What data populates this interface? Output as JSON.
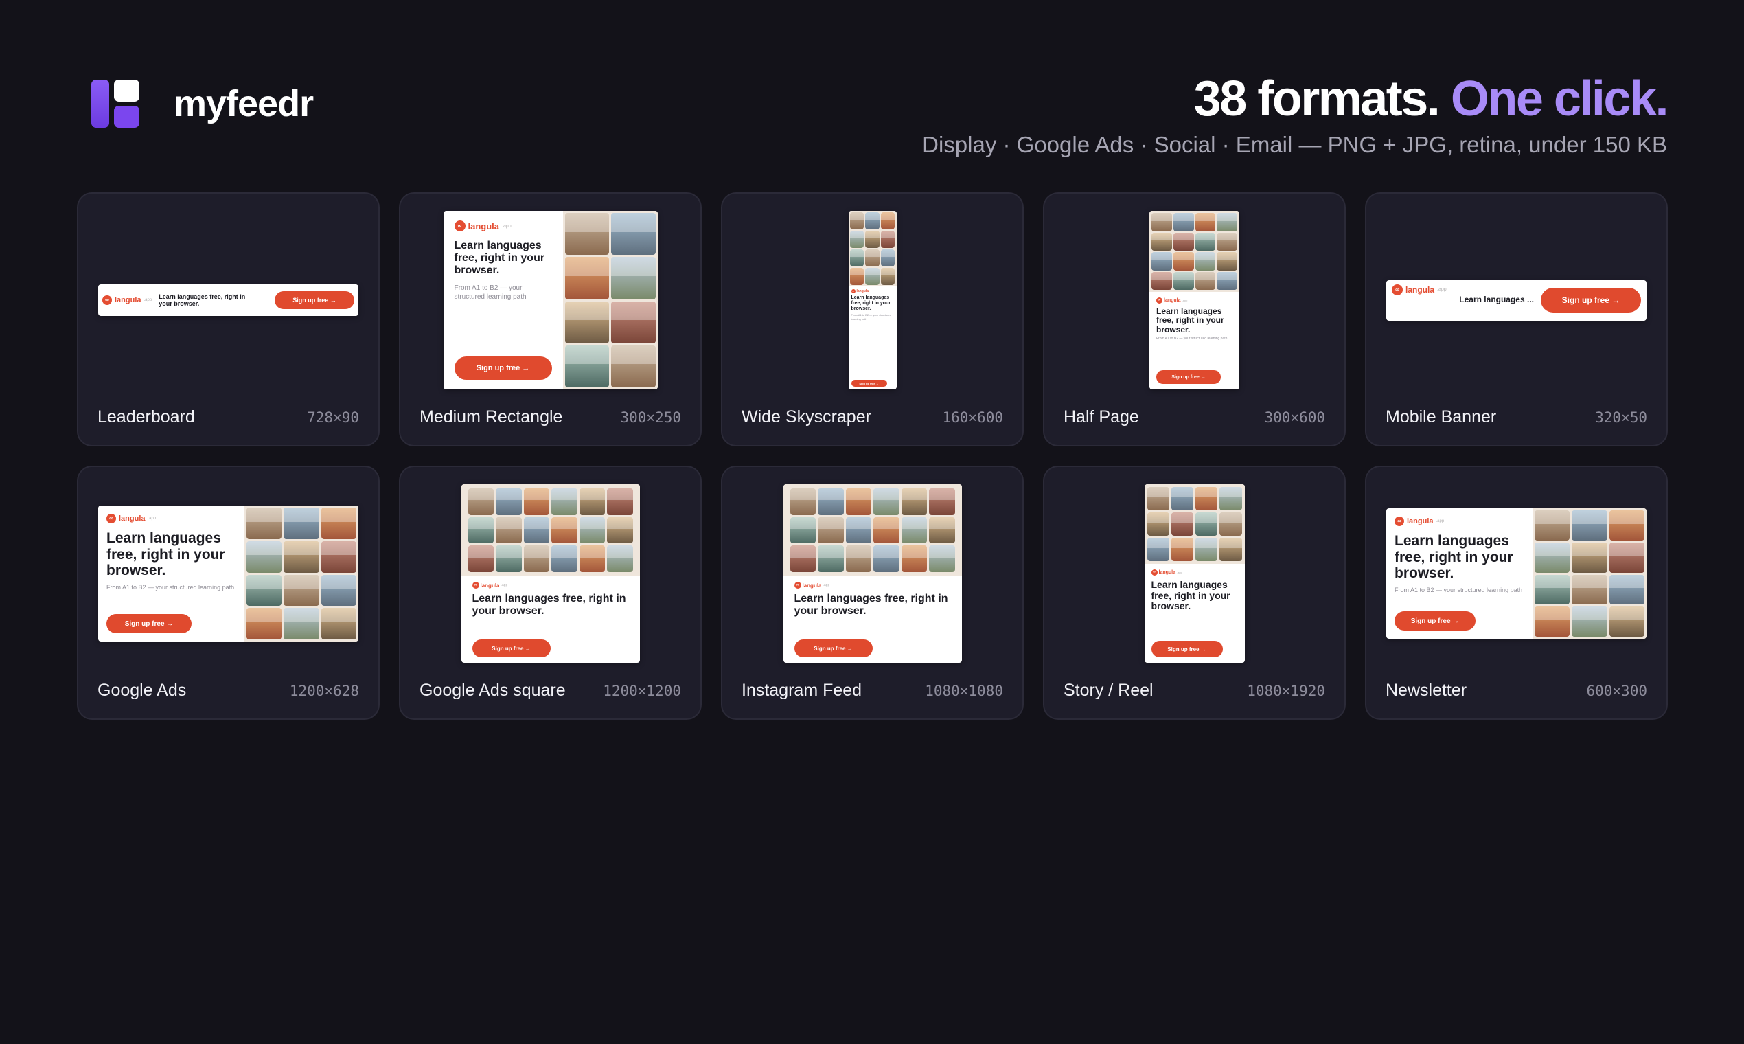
{
  "brand": {
    "name": "myfeedr"
  },
  "headline": {
    "part1": "38 formats.",
    "part2": "One click.",
    "subtitle": "Display · Google Ads · Social · Email — PNG + JPG, retina, under 150 KB"
  },
  "ad_copy": {
    "logo": "langula",
    "logo_suffix": ".app",
    "headline": "Learn languages free, right in your browser.",
    "headline_short": "Learn languages ...",
    "description": "From A1 to B2 — your structured learning path",
    "cta": "Sign up free →"
  },
  "formats": [
    {
      "name": "Leaderboard",
      "size": "728×90"
    },
    {
      "name": "Medium Rectangle",
      "size": "300×250"
    },
    {
      "name": "Wide Skyscraper",
      "size": "160×600"
    },
    {
      "name": "Half Page",
      "size": "300×600"
    },
    {
      "name": "Mobile Banner",
      "size": "320×50"
    },
    {
      "name": "Google Ads",
      "size": "1200×628"
    },
    {
      "name": "Google Ads square",
      "size": "1200×1200"
    },
    {
      "name": "Instagram Feed",
      "size": "1080×1080"
    },
    {
      "name": "Story / Reel",
      "size": "1080×1920"
    },
    {
      "name": "Newsletter",
      "size": "600×300"
    }
  ],
  "colors": {
    "background": "#131219",
    "card": "#1e1d2a",
    "accent": "#a88bf7",
    "cta": "#e04a2e",
    "brand_logo": "#e44d32"
  }
}
